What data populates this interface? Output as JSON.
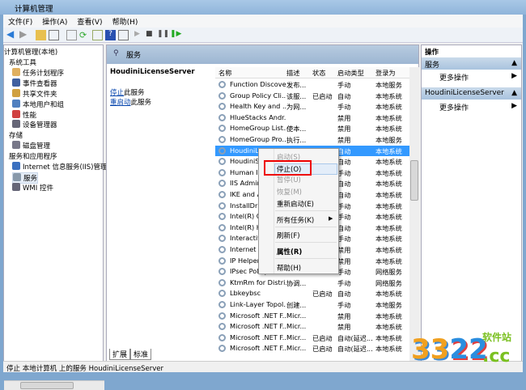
{
  "window": {
    "title": "计算机管理"
  },
  "menu": [
    "文件(F)",
    "操作(A)",
    "查看(V)",
    "帮助(H)"
  ],
  "tree": {
    "root": "计算机管理(本地)",
    "items": [
      {
        "label": "系统工具",
        "level": 1
      },
      {
        "label": "任务计划程序",
        "level": 2
      },
      {
        "label": "事件查看器",
        "level": 2
      },
      {
        "label": "共享文件夹",
        "level": 2
      },
      {
        "label": "本地用户和组",
        "level": 2
      },
      {
        "label": "性能",
        "level": 2
      },
      {
        "label": "设备管理器",
        "level": 2
      },
      {
        "label": "存储",
        "level": 1
      },
      {
        "label": "磁盘管理",
        "level": 2
      },
      {
        "label": "服务和应用程序",
        "level": 1
      },
      {
        "label": "Internet 信息服务(IIS)管理器",
        "level": 2
      },
      {
        "label": "服务",
        "level": 2,
        "selected": true
      },
      {
        "label": "WMI 控件",
        "level": 2
      }
    ]
  },
  "middle": {
    "header": "服务",
    "service_name": "HoudiniLicenseServer",
    "stop_link": "停止",
    "stop_suffix": "此服务",
    "restart_link": "重启动",
    "restart_suffix": "此服务",
    "columns": [
      "名称",
      "描述",
      "状态",
      "启动类型",
      "登录为"
    ],
    "rows": [
      [
        "Function Discove...",
        "发布...",
        "",
        "手动",
        "本地服务"
      ],
      [
        "Group Policy Cli...",
        "该服...",
        "已启动",
        "自动",
        "本地系统"
      ],
      [
        "Health Key and ...",
        "为网...",
        "",
        "手动",
        "本地系统"
      ],
      [
        "HlueStacks Andr...",
        "",
        "",
        "禁用",
        "本地系统"
      ],
      [
        "HomeGroup List...",
        "使本...",
        "",
        "禁用",
        "本地系统"
      ],
      [
        "HomeGroup Pro...",
        "执行...",
        "",
        "禁用",
        "本地服务"
      ],
      [
        "HoudiniLicenseS...",
        "",
        "已启动",
        "自动",
        "本地系统"
      ],
      [
        "HoudiniS...",
        "",
        "",
        "自动",
        "本地系统"
      ],
      [
        "Human In...",
        "",
        "",
        "手动",
        "本地系统"
      ],
      [
        "IIS Admin...",
        "",
        "",
        "自动",
        "本地系统"
      ],
      [
        "IKE and A...",
        "",
        "",
        "自动",
        "本地系统"
      ],
      [
        "InstallDriv...",
        "",
        "",
        "手动",
        "本地系统"
      ],
      [
        "Intel(R) C...",
        "",
        "",
        "手动",
        "本地系统"
      ],
      [
        "Intel(R) H...",
        "",
        "",
        "自动",
        "本地系统"
      ],
      [
        "Interactive...",
        "",
        "",
        "手动",
        "本地系统"
      ],
      [
        "Internet C...",
        "",
        "",
        "禁用",
        "本地系统"
      ],
      [
        "IP Helper...",
        "",
        "",
        "禁用",
        "本地系统"
      ],
      [
        "IPsec Policy...",
        "",
        "",
        "手动",
        "网络服务"
      ],
      [
        "KtmRm for Distri...",
        "协调...",
        "",
        "手动",
        "网络服务"
      ],
      [
        "Lbkeybsc",
        "",
        "已启动",
        "自动",
        "本地系统"
      ],
      [
        "Link-Layer Topol...",
        "创建...",
        "",
        "手动",
        "本地服务"
      ],
      [
        "Microsoft .NET F...",
        "Micr...",
        "",
        "禁用",
        "本地系统"
      ],
      [
        "Microsoft .NET F...",
        "Micr...",
        "",
        "禁用",
        "本地系统"
      ],
      [
        "Microsoft .NET F...",
        "Micr...",
        "已启动",
        "自动(延迟...",
        "本地系统"
      ],
      [
        "Microsoft .NET F...",
        "Micr...",
        "已启动",
        "自动(延迟...",
        "本地系统"
      ]
    ],
    "selected_row": 6,
    "tabs": [
      "扩展",
      "标准"
    ]
  },
  "context_menu": [
    {
      "label": "启动(S)",
      "disabled": true
    },
    {
      "label": "停止(O)",
      "highlighted": true
    },
    {
      "label": "暂停(U)",
      "disabled": true
    },
    {
      "label": "恢复(M)",
      "disabled": true
    },
    {
      "label": "重新启动(E)"
    },
    {
      "label": "所有任务(K)",
      "submenu": true
    },
    {
      "label": "刷新(F)"
    },
    {
      "label": "属性(R)",
      "bold": true
    },
    {
      "label": "帮助(H)"
    }
  ],
  "actions": {
    "title": "操作",
    "sections": [
      {
        "header": "服务",
        "item": "更多操作"
      },
      {
        "header": "HoudiniLicenseServer",
        "item": "更多操作"
      }
    ]
  },
  "status": "停止 本地计算机 上的服务 HoudiniLicenseServer",
  "watermark": {
    "text": "3322.cc",
    "sub": "软件站"
  }
}
